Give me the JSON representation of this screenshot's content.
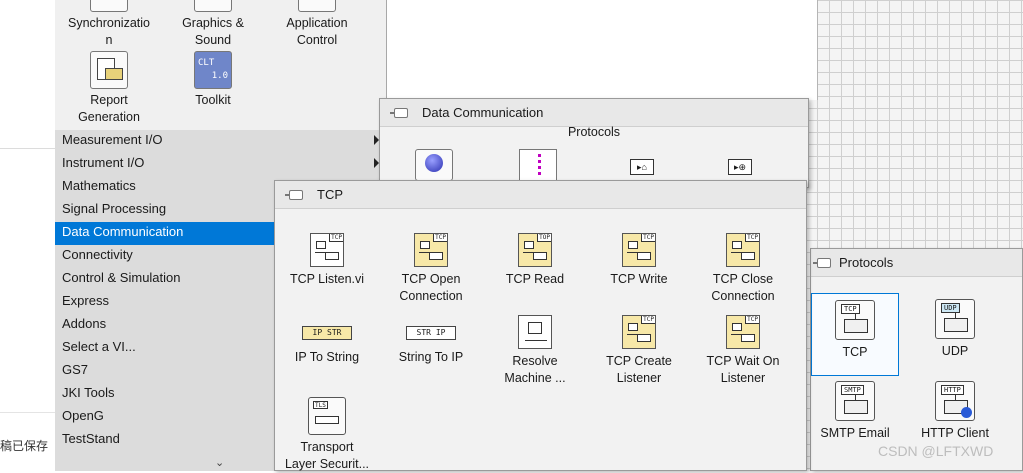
{
  "top_palette": {
    "items": [
      {
        "label": "Synchronizatio\nn",
        "icon": "synchronization-icon"
      },
      {
        "label": "Graphics &\nSound",
        "icon": "graphics-sound-icon"
      },
      {
        "label": "Application\nControl",
        "icon": "application-control-icon"
      },
      {
        "label": "Report\nGeneration",
        "icon": "report-generation-icon"
      },
      {
        "label": "Toolkit",
        "icon": "toolkit-icon",
        "badge": "CLT",
        "version": "1.0"
      }
    ]
  },
  "category_menu": {
    "items": [
      {
        "label": "Measurement I/O",
        "submenu": true
      },
      {
        "label": "Instrument I/O",
        "submenu": true
      },
      {
        "label": "Mathematics"
      },
      {
        "label": "Signal Processing"
      },
      {
        "label": "Data Communication",
        "selected": true
      },
      {
        "label": "Connectivity"
      },
      {
        "label": "Control & Simulation"
      },
      {
        "label": "Express"
      },
      {
        "label": "Addons"
      },
      {
        "label": "Select a VI..."
      },
      {
        "label": "GS7"
      },
      {
        "label": "JKI Tools"
      },
      {
        "label": "OpenG"
      },
      {
        "label": "TestStand"
      }
    ],
    "more_indicator": "⌄"
  },
  "data_comm_palette": {
    "title": "Data Communication",
    "section": "Protocols"
  },
  "tcp_palette": {
    "title": "TCP",
    "items": [
      {
        "label": "TCP Listen.vi",
        "tag": "TCP"
      },
      {
        "label": "TCP Open\nConnection",
        "tag": "TCP"
      },
      {
        "label": "TCP Read",
        "tag": "TOP"
      },
      {
        "label": "TCP Write",
        "tag": "TCP"
      },
      {
        "label": "TCP Close\nConnection",
        "tag": "TCP"
      },
      {
        "label": "IP To String",
        "tag": "IP STR"
      },
      {
        "label": "String To IP",
        "tag": "STR IP"
      },
      {
        "label": "Resolve\nMachine ...",
        "tag": ""
      },
      {
        "label": "TCP Create\nListener",
        "tag": "TCP"
      },
      {
        "label": "TCP Wait On\nListener",
        "tag": "TCP"
      },
      {
        "label": "Transport\nLayer Securit...",
        "tag": "TLS"
      }
    ]
  },
  "protocols_palette": {
    "title": "Protocols",
    "items": [
      {
        "label": "TCP",
        "tag": "TCP",
        "selected": true
      },
      {
        "label": "UDP",
        "tag": "UDP"
      },
      {
        "label": "SMTP Email",
        "tag": "SMTP"
      },
      {
        "label": "HTTP Client",
        "tag": "HTTP"
      }
    ]
  },
  "status": {
    "saved_text": "稿已保存"
  },
  "watermark": "CSDN @LFTXWD"
}
